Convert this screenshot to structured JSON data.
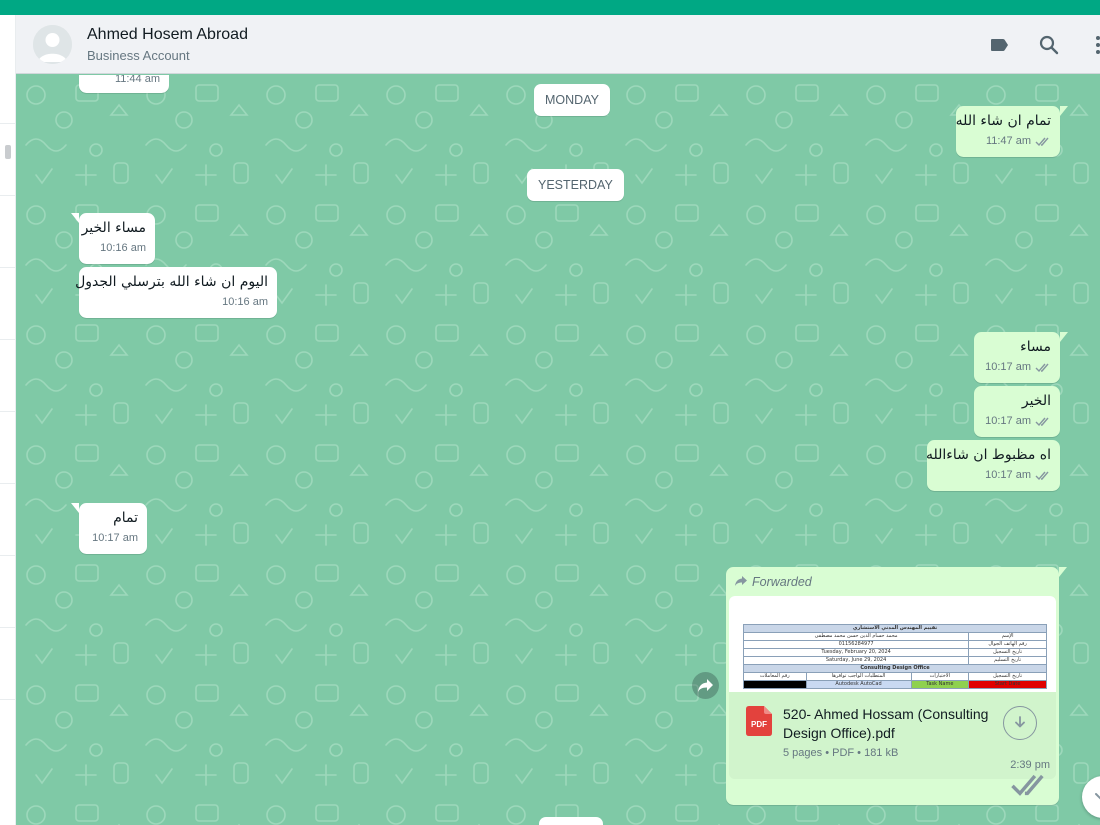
{
  "colors": {
    "accent": "#00a884",
    "chat_background": "#7fc9a6",
    "incoming_bubble": "#ffffff",
    "outgoing_bubble": "#d9fdd3",
    "pdf_red": "#e3423d"
  },
  "header": {
    "contact_name": "Ahmed Hosem Abroad",
    "contact_subtitle": "Business Account",
    "icons": [
      "label-icon",
      "search-icon",
      "menu-icon"
    ]
  },
  "dates": {
    "monday": "MONDAY",
    "yesterday": "YESTERDAY"
  },
  "messages": [
    {
      "dir": "in",
      "text": "",
      "time": "11:44 am"
    },
    {
      "dir": "out",
      "text": "تمام ان شاء الله",
      "time": "11:47 am"
    },
    {
      "dir": "in",
      "text": "مساء الخير",
      "time": "10:16 am"
    },
    {
      "dir": "in",
      "text": "اليوم ان شاء الله بترسلي الجدول",
      "time": "10:16 am"
    },
    {
      "dir": "out",
      "text": "مساء",
      "time": "10:17 am"
    },
    {
      "dir": "out",
      "text": "الخير",
      "time": "10:17 am"
    },
    {
      "dir": "out",
      "text": "اه مظبوط ان شاءالله",
      "time": "10:17 am"
    },
    {
      "dir": "in",
      "text": "تمام",
      "time": "10:17 am"
    }
  ],
  "document_message": {
    "forwarded_label": "Forwarded",
    "file_name": "520- Ahmed Hossam (Consulting Design Office).pdf",
    "file_meta": "5 pages • PDF • 181 kB",
    "file_type_badge": "PDF",
    "time": "2:39 pm",
    "preview": {
      "title": "تقييم المهندس المدني الاستشاري",
      "rows": [
        [
          "الإسم",
          "محمد حسام الدين حسن محمد مصطفى"
        ],
        [
          "رقم الهاتف الجوال",
          "01156284977"
        ],
        [
          "تاريخ التسجيل",
          "Tuesday, February 20, 2024"
        ],
        [
          "تاريخ التسليم",
          "Saturday, June 29, 2024"
        ]
      ],
      "section": "Consulting Design Office",
      "col_headers": [
        "رقم المعاملات",
        "المتطلبات الواجب توافرها",
        "الاختبارات",
        "تاريخ التسجيل"
      ],
      "col_values": [
        "",
        "Autodesk AutoCad",
        "Task Name",
        "Start Date"
      ]
    }
  }
}
